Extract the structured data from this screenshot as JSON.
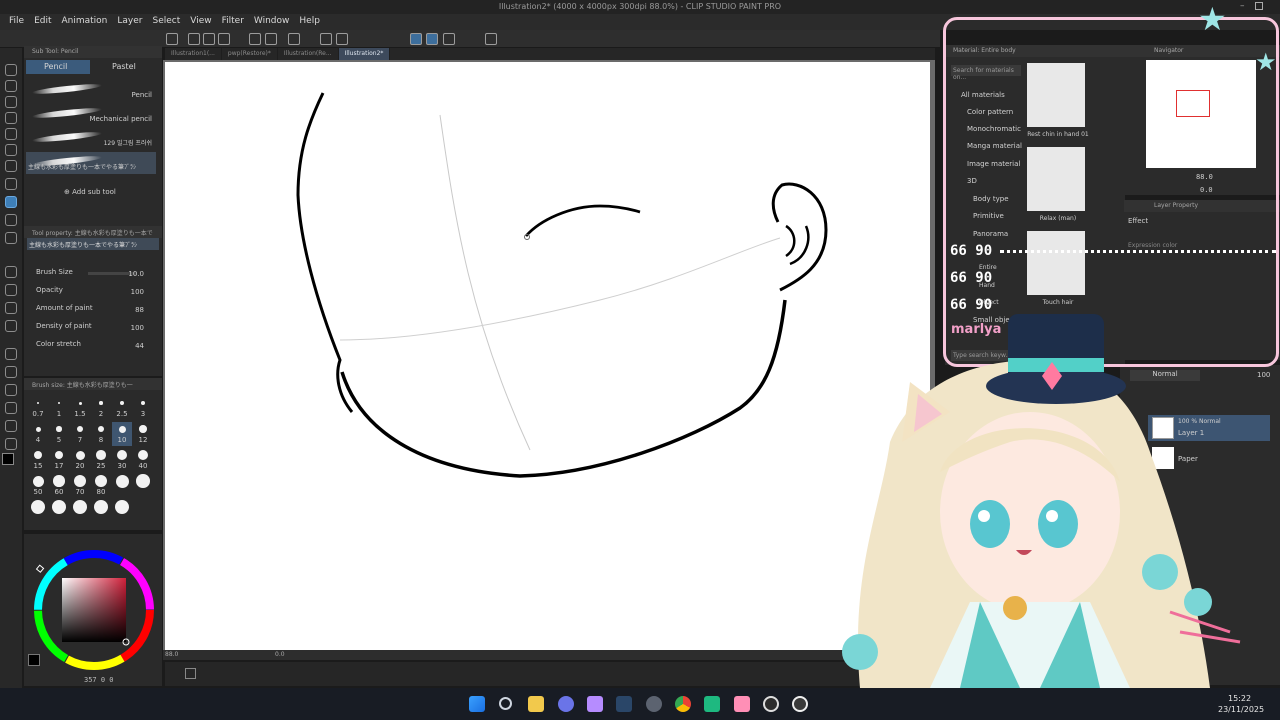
{
  "window": {
    "title": "Illustration2* (4000 x 4000px 300dpi 88.0%) - CLIP STUDIO PAINT PRO"
  },
  "menu": [
    "File",
    "Edit",
    "Animation",
    "Layer",
    "Select",
    "View",
    "Filter",
    "Window",
    "Help"
  ],
  "document_tabs": [
    {
      "label": "Illustration1(...",
      "active": false
    },
    {
      "label": "pwp(Restore)*",
      "active": false
    },
    {
      "label": "Illustration(Re...",
      "active": false
    },
    {
      "label": "Illustration2*",
      "active": true
    }
  ],
  "sub_tool": {
    "header": "Sub Tool: Pencil",
    "tabs": [
      "Pencil",
      "Pastel"
    ],
    "brushes": [
      {
        "label": "Pencil"
      },
      {
        "label": "Mechanical pencil"
      },
      {
        "label": "129 밀그림 프러쉬"
      },
      {
        "label": "主線も水彩も厚塗りも一本でやる筆ﾌﾞﾗｼ"
      }
    ],
    "add_label": "Add sub tool"
  },
  "tool_property": {
    "header": "Tool property: 主線も水彩も厚塗りも一本でやる筆",
    "brush_name": "主線も水彩も厚塗りも一本でやる筆ﾌﾞﾗｼ",
    "props": [
      {
        "label": "Brush Size",
        "value": "10.0"
      },
      {
        "label": "Opacity",
        "value": "100"
      },
      {
        "label": "Amount of paint",
        "value": "88"
      },
      {
        "label": "Density of paint",
        "value": "100"
      },
      {
        "label": "Color stretch",
        "value": "44"
      }
    ]
  },
  "brush_size": {
    "header": "Brush size: 主線も水彩も厚塗りも一",
    "sizes": [
      "0.7",
      "1",
      "1.5",
      "2",
      "2.5",
      "3",
      "4",
      "5",
      "7",
      "8",
      "10",
      "12",
      "15",
      "17",
      "20",
      "25",
      "30",
      "40",
      "50",
      "60",
      "70",
      "80",
      "100",
      "120",
      "150",
      "170",
      "200",
      "250",
      "300"
    ],
    "selected": "10"
  },
  "color": {
    "main": "#000000",
    "sub": "#ffffff",
    "readout": "357  0  0",
    "hue_marker": "#c2303a"
  },
  "status": {
    "zoom": "88.0",
    "angle": "0.0"
  },
  "material": {
    "header": "Material: Entire body",
    "search_placeholder": "Search for materials on...",
    "tree": [
      "All materials",
      "Color pattern",
      "Monochromatic",
      "Manga material",
      "Image material",
      "3D",
      "Body type",
      "Primitive",
      "Panorama",
      "Entire",
      "Hand",
      "Object",
      "Small object"
    ],
    "items": [
      {
        "label": "Rest chin in hand 01"
      },
      {
        "label": "Relax (man)"
      },
      {
        "label": "Touch hair"
      }
    ],
    "type_placeholder": "Type search keyw..."
  },
  "navigator": {
    "header": "Navigator",
    "zoom": "88.0",
    "angle": "0.0"
  },
  "layer_property": {
    "header": "Layer Property",
    "effect": "Effect",
    "expression": "Expression color"
  },
  "layers": {
    "blend": "Normal",
    "opacity": "100",
    "items": [
      {
        "line1": "100 % Normal",
        "line2": "Layer 1",
        "selected": true
      },
      {
        "line1": "",
        "line2": "Paper",
        "selected": false
      }
    ]
  },
  "overlay": {
    "counters": [
      "66 90",
      "66 90",
      "66 90"
    ],
    "name": "marlya"
  },
  "taskbar": {
    "time": "15:22",
    "date": "23/11/2025"
  }
}
